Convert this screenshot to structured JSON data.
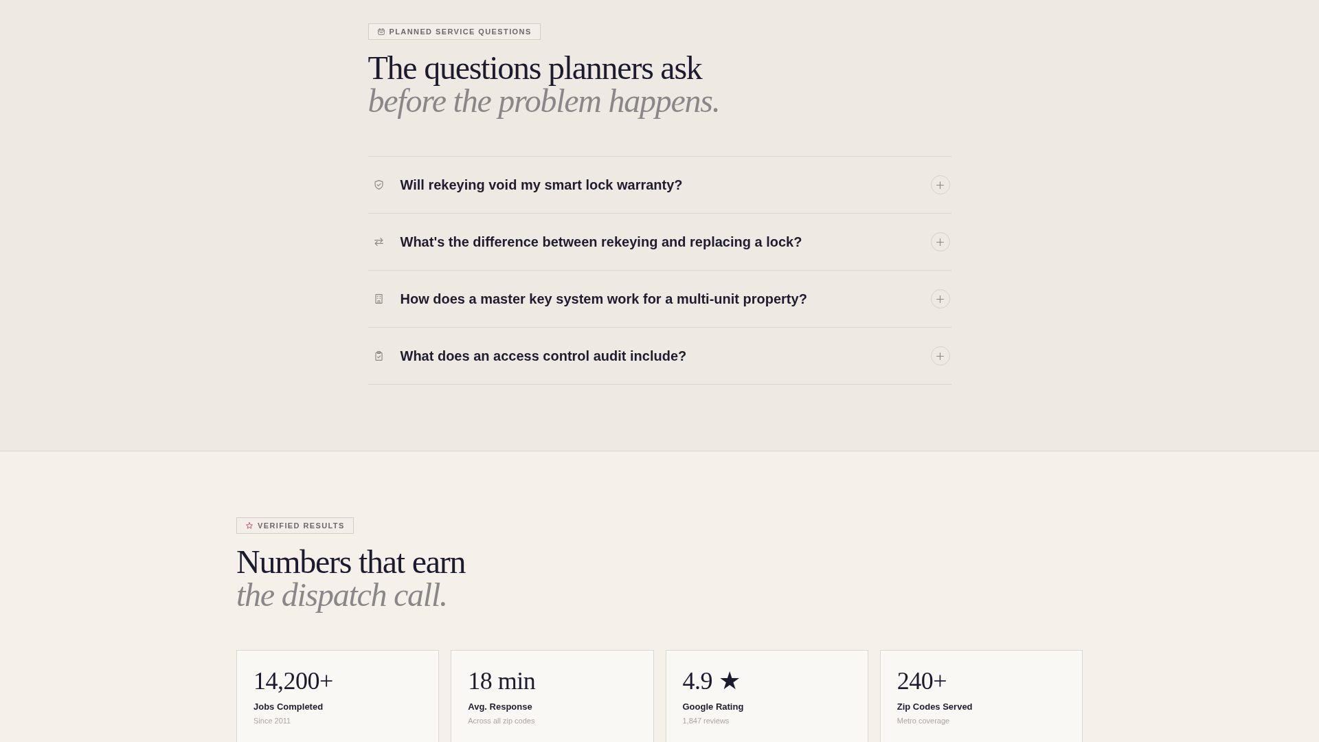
{
  "faq_section": {
    "badge": "PLANNED SERVICE QUESTIONS",
    "heading": "The questions planners ask",
    "heading_accent": "before the problem happens.",
    "items": [
      {
        "question": "Will rekeying void my smart lock warranty?",
        "expanded": false
      },
      {
        "question": "What's the difference between rekeying and replacing a lock?",
        "expanded": false
      },
      {
        "question": "How does a master key system work for a multi-unit property?",
        "expanded": false
      },
      {
        "question": "What does an access control audit include?",
        "expanded": false
      }
    ]
  },
  "results_section": {
    "badge": "VERIFIED RESULTS",
    "heading": "Numbers that earn",
    "heading_accent": "the dispatch call.",
    "stats": [
      {
        "value": "14,200+",
        "label": "Jobs Completed",
        "note": "Since 2011"
      },
      {
        "value": "18 min",
        "label": "Avg. Response",
        "note": "Across all zip codes"
      },
      {
        "value": "4.9 ★",
        "label": "Google Rating",
        "note": "1,847 reviews"
      },
      {
        "value": "240+",
        "label": "Zip Codes Served",
        "note": "Metro coverage"
      }
    ]
  }
}
